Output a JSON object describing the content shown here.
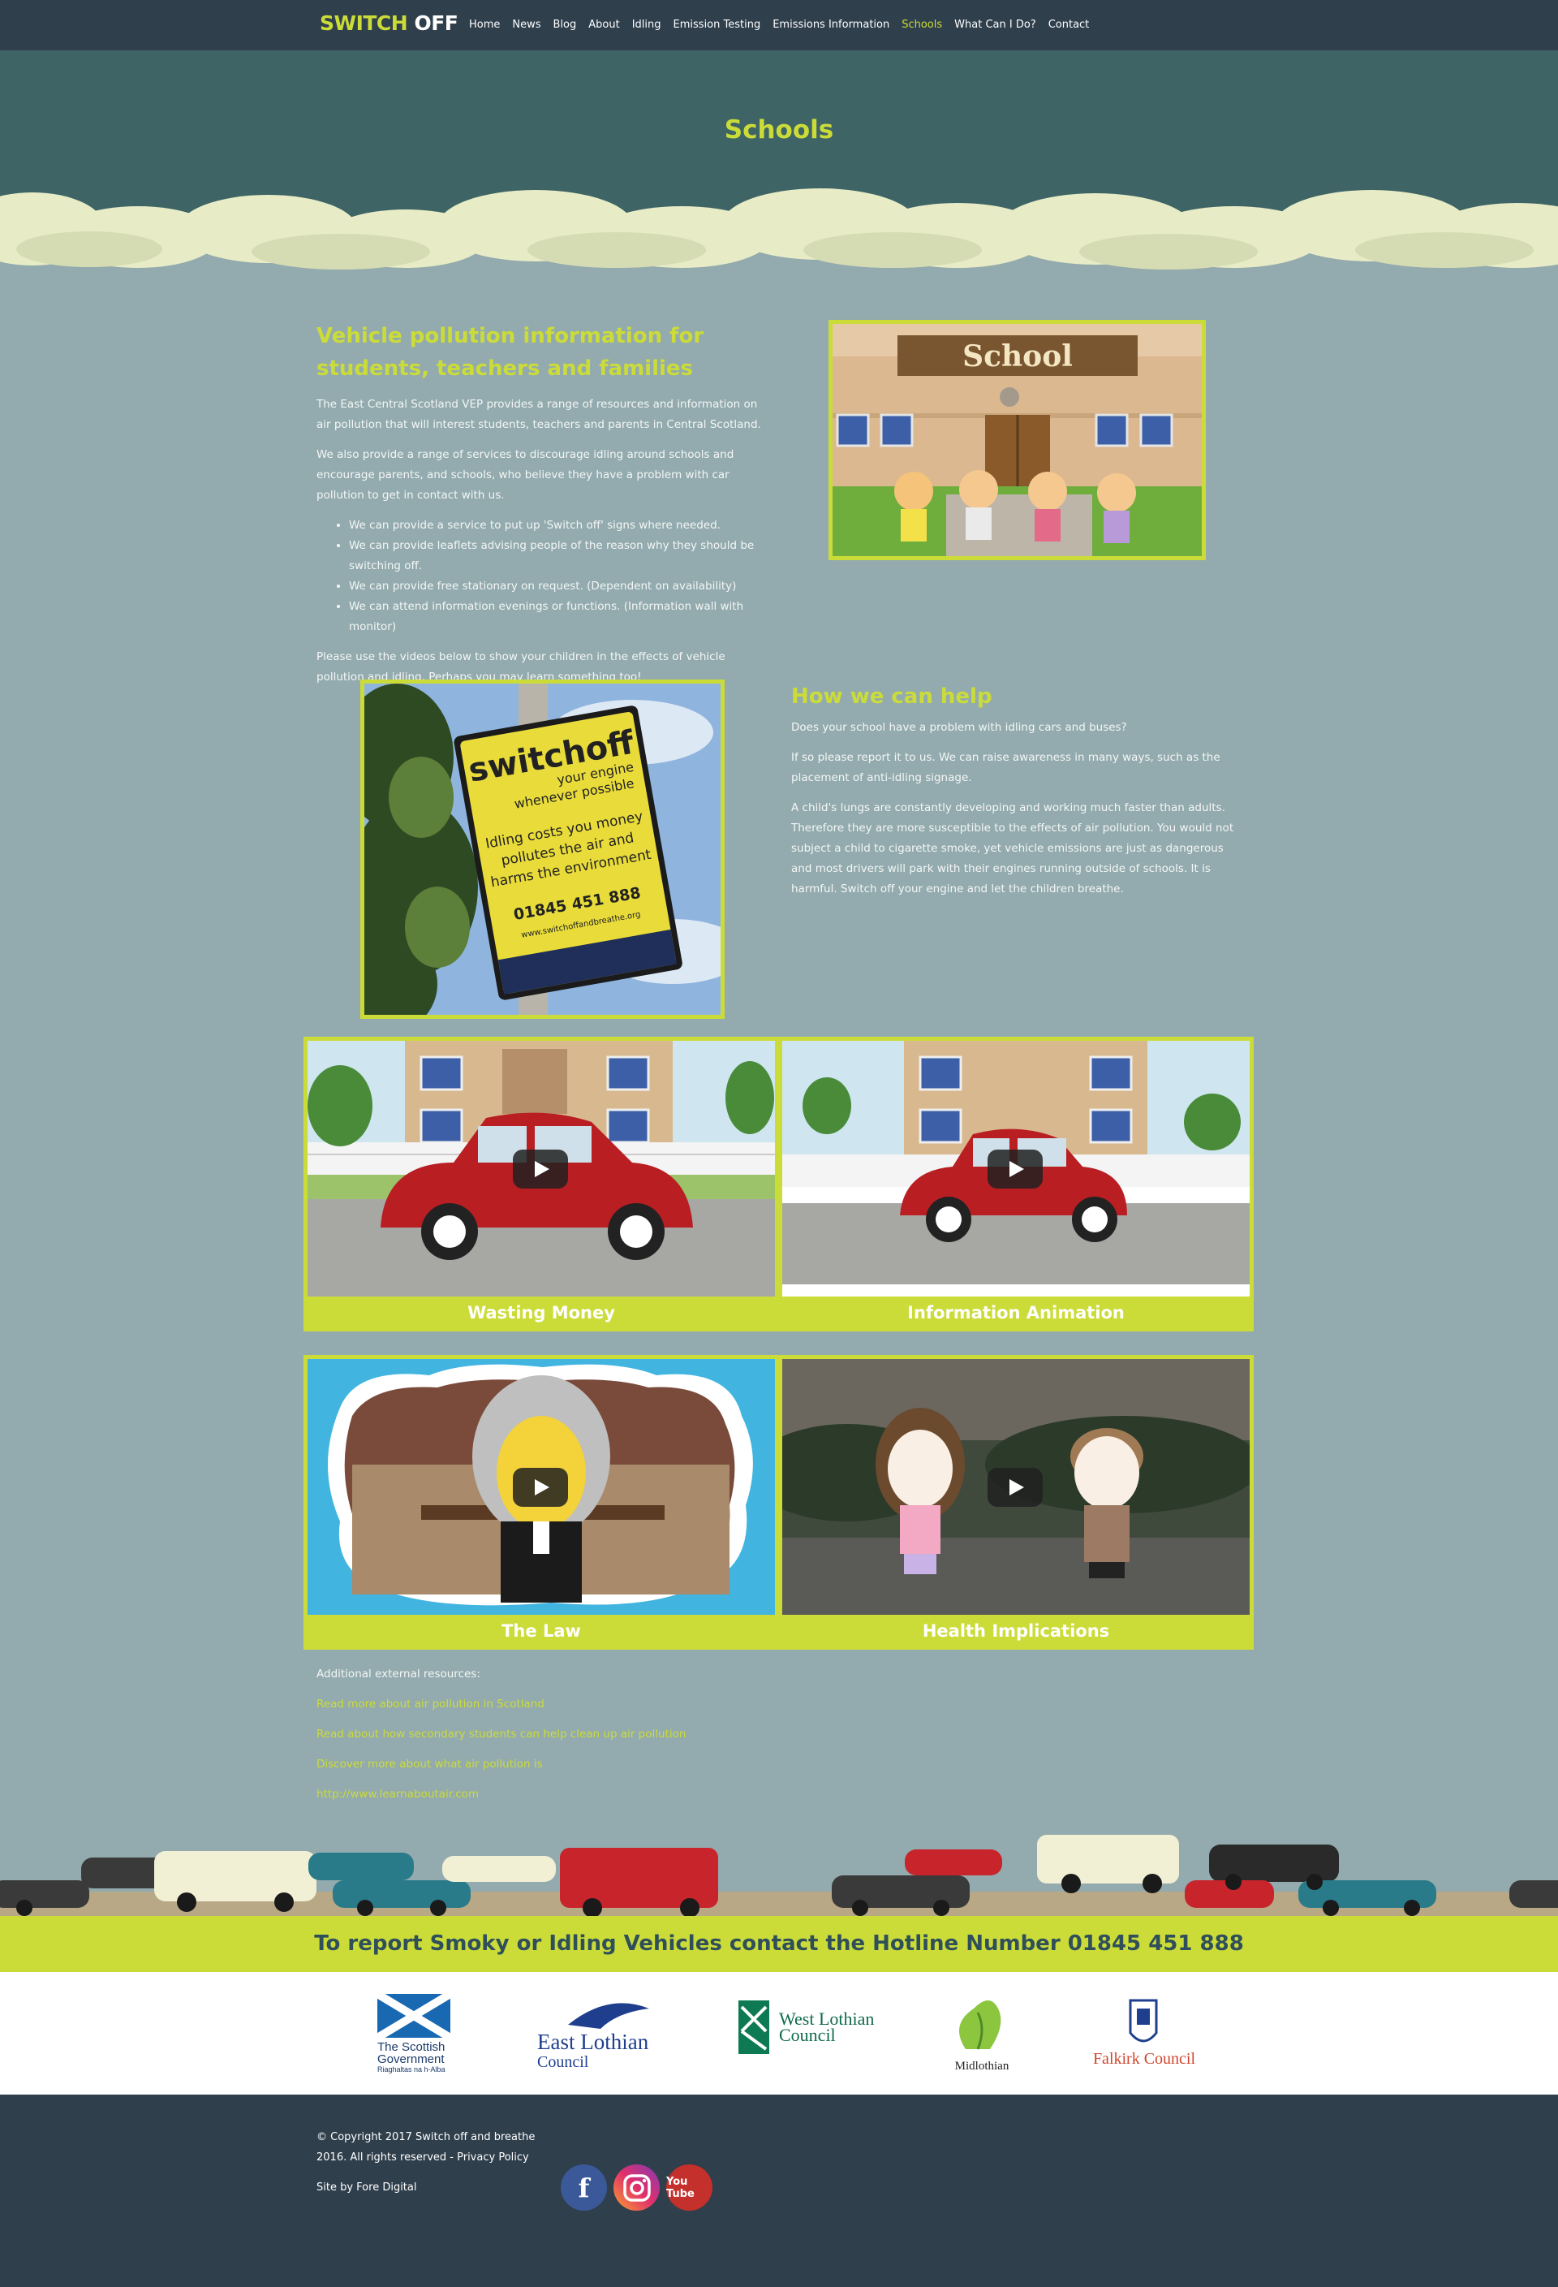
{
  "nav": {
    "logo_part1": "SWITCH",
    "logo_part2": "OFF",
    "items": [
      "Home",
      "News",
      "Blog",
      "About",
      "Idling",
      "Emission Testing",
      "Emissions Information",
      "Schools",
      "What Can I Do?",
      "Contact"
    ],
    "active": "Schools"
  },
  "hero": {
    "title": "Schools"
  },
  "intro": {
    "heading": "Vehicle pollution information for students, teachers and families",
    "p1": "The East Central Scotland VEP provides a range of resources and information on air pollution that will interest students, teachers and parents in Central Scotland.",
    "p2": "We also provide a range of services to discourage idling around schools and encourage parents, and schools, who believe they have a problem with car pollution to get in contact with us.",
    "bullets": [
      "We can provide a service to put up 'Switch off' signs where needed.",
      "We can provide leaflets advising people of the reason why they should be switching off.",
      "We can provide free stationary on request. (Dependent on availability)",
      "We can attend information evenings or functions. (Information wall with monitor)"
    ],
    "p3": "Please use the videos below to show your children in the effects of vehicle pollution and idling. Perhaps you may learn something too!"
  },
  "school_image": {
    "sign_text": "School"
  },
  "sign_image": {
    "brand": "switchoff",
    "tagline1": "your engine",
    "tagline2": "whenever possible",
    "msg1": "Idling costs you money",
    "msg2": "pollutes the air and",
    "msg3": "harms the environment",
    "phone": "01845 451 888",
    "url": "www.switchoffandbreathe.org"
  },
  "help": {
    "heading": "How we can help",
    "p1": "Does your school have a problem with idling cars and buses?",
    "p2": "If so please report it to us. We can raise awareness in many ways, such as the placement of anti-idling signage.",
    "p3": "A child's lungs are constantly developing and working much faster than adults. Therefore they are more susceptible to the effects of air pollution. You would not subject a child to cigarette smoke, yet vehicle emissions are just as dangerous and most drivers will park with their engines running outside of schools. It is harmful. Switch off your engine and let the children breathe."
  },
  "videos": [
    {
      "caption": "Wasting Money"
    },
    {
      "caption": "Information Animation"
    },
    {
      "caption": "The Law"
    },
    {
      "caption": "Health Implications"
    }
  ],
  "resources": {
    "label": "Additional external resources:",
    "links": [
      "Read more about air pollution in Scotland",
      "Read about how secondary students can help clean up air pollution",
      "Discover more about what air pollution is",
      "http://www.learnaboutair.com"
    ]
  },
  "hotline": {
    "text": "To report Smoky or Idling Vehicles contact the Hotline Number 01845 451 888"
  },
  "partners": {
    "scot_gov_1": "The Scottish",
    "scot_gov_2": "Government",
    "scot_gov_3": "Riaghaltas na h-Alba",
    "east_lothian_1": "East Lothian",
    "east_lothian_2": "Council",
    "west_lothian_1": "West Lothian",
    "west_lothian_2": "Council",
    "midlothian": "Midlothian",
    "falkirk": "Falkirk Council"
  },
  "footer": {
    "copyright": "© Copyright 2017 Switch off and breathe 2016. All rights reserved - Privacy Policy",
    "site_by": "Site by Fore Digital",
    "social": {
      "facebook": "f",
      "youtube": "You Tube"
    }
  },
  "colors": {
    "accent": "#cbdc38",
    "nav_bg": "#2f3f4c",
    "hero_bg": "#3e6466",
    "page_bg": "#93abae"
  }
}
